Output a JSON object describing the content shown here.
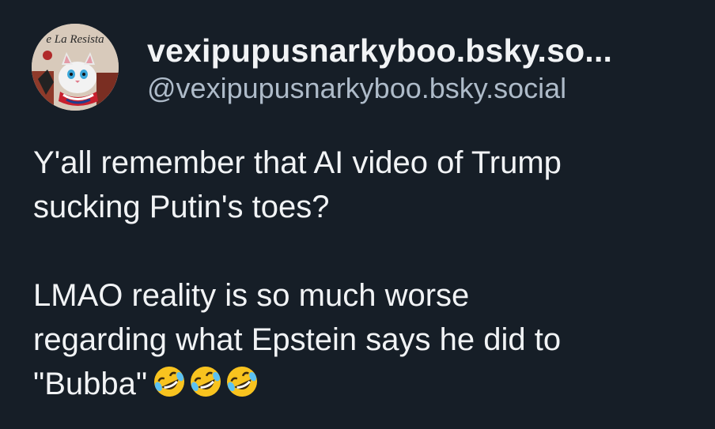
{
  "post": {
    "author": {
      "display_name": "vexipupusnarkyboo.bsky.so...",
      "handle": "@vexipupusnarkyboo.bsky.social",
      "avatar_text": "e La Resista"
    },
    "body": {
      "paragraph_1": {
        "line_1": "Y'all remember that AI video of Trump",
        "line_2": "sucking Putin's toes?"
      },
      "paragraph_2": {
        "line_1": "LMAO reality is so much worse",
        "line_2": "regarding what Epstein says he did to",
        "line_3": "\"Bubba\""
      },
      "emojis": [
        "rolling-on-floor-laughing",
        "rolling-on-floor-laughing",
        "rolling-on-floor-laughing"
      ]
    },
    "colors": {
      "background": "#161e27",
      "text_primary": "#f1f3f5",
      "text_secondary": "#aebbc9"
    }
  }
}
